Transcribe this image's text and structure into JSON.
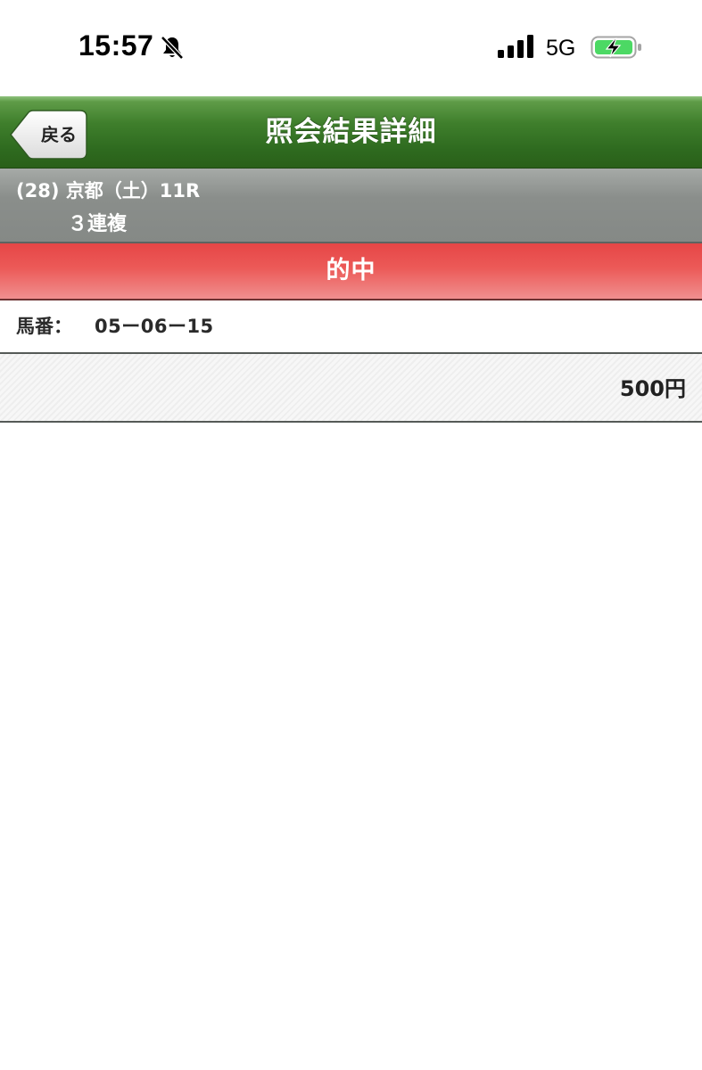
{
  "status_bar": {
    "time": "15:57",
    "network": "5G",
    "icons": [
      "bell-slash-icon",
      "cellular-signal-icon",
      "battery-charging-icon"
    ],
    "battery_color": "#4cd964"
  },
  "nav": {
    "back_label": "戻る",
    "title": "照会結果詳細",
    "color": "#2e6a1f"
  },
  "race": {
    "line1": "(28) 京都（土）11R",
    "line2": "３連複"
  },
  "result": {
    "label": "的中",
    "color": "#e64646"
  },
  "bet": {
    "horse_label": "馬番：",
    "horse_value": "05ー06ー15",
    "amount": "500円"
  }
}
